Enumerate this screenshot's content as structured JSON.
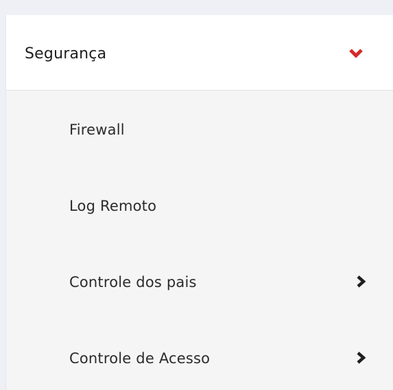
{
  "menu": {
    "section": {
      "title": "Segurança",
      "expanded": true,
      "icon": "chevron-down-icon",
      "accent_color": "#d42a2a"
    },
    "items": [
      {
        "label": "Firewall",
        "has_submenu": false
      },
      {
        "label": "Log Remoto",
        "has_submenu": false
      },
      {
        "label": "Controle dos pais",
        "has_submenu": true,
        "icon": "chevron-right-icon"
      },
      {
        "label": "Controle de Acesso",
        "has_submenu": true,
        "icon": "chevron-right-icon"
      }
    ]
  }
}
